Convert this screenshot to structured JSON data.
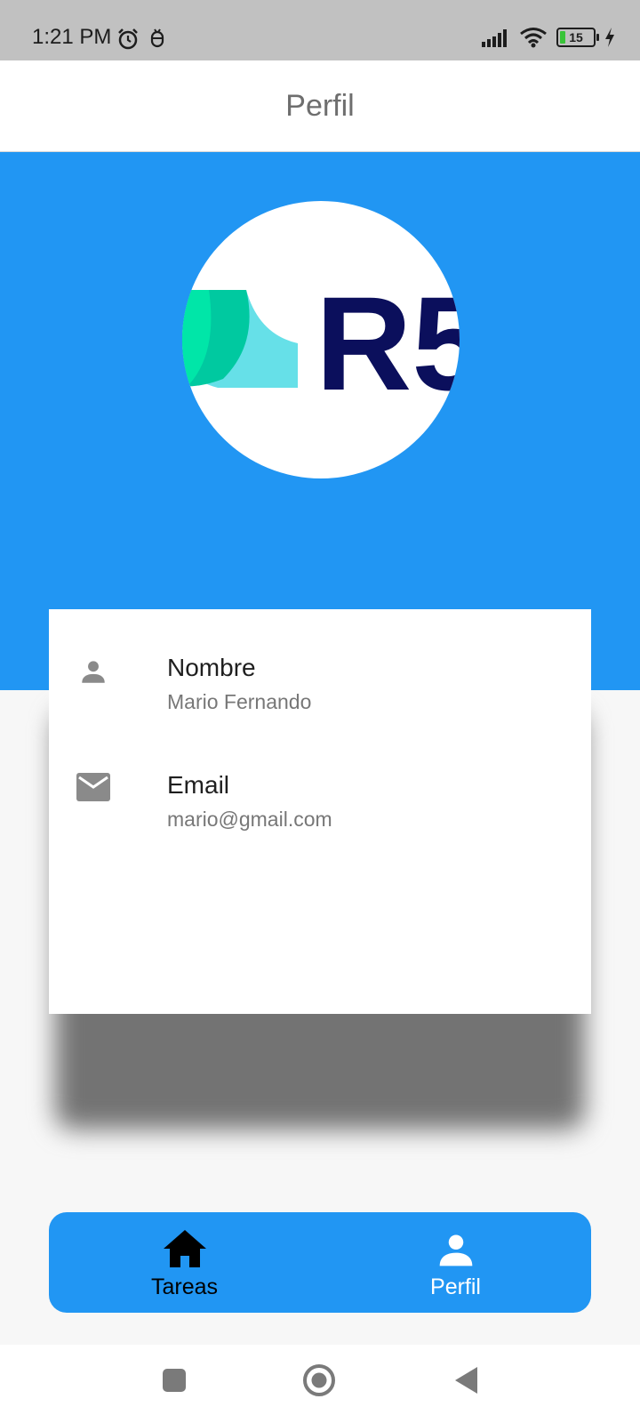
{
  "status_bar": {
    "time": "1:21 PM",
    "battery_level": "15",
    "icons": [
      "alarm-icon",
      "debug-icon",
      "signal-icon",
      "wifi-icon",
      "battery-icon",
      "charging-icon"
    ]
  },
  "app_bar": {
    "title": "Perfil"
  },
  "profile": {
    "avatar_logo_text": "R5",
    "fields": [
      {
        "icon": "person-icon",
        "label": "Nombre",
        "value": "Mario Fernando"
      },
      {
        "icon": "email-icon",
        "label": "Email",
        "value": "mario@gmail.com"
      }
    ]
  },
  "bottom_nav": {
    "items": [
      {
        "icon": "home-icon",
        "label": "Tareas",
        "active": false
      },
      {
        "icon": "person-icon",
        "label": "Perfil",
        "active": true
      }
    ]
  },
  "system_nav": {
    "icons": [
      "recents-icon",
      "home-circle-icon",
      "back-icon"
    ]
  },
  "colors": {
    "primary": "#2196f3",
    "logo_dark": "#0b0f5c",
    "logo_green": "#00e6a8",
    "logo_teal": "#66e0e8"
  }
}
